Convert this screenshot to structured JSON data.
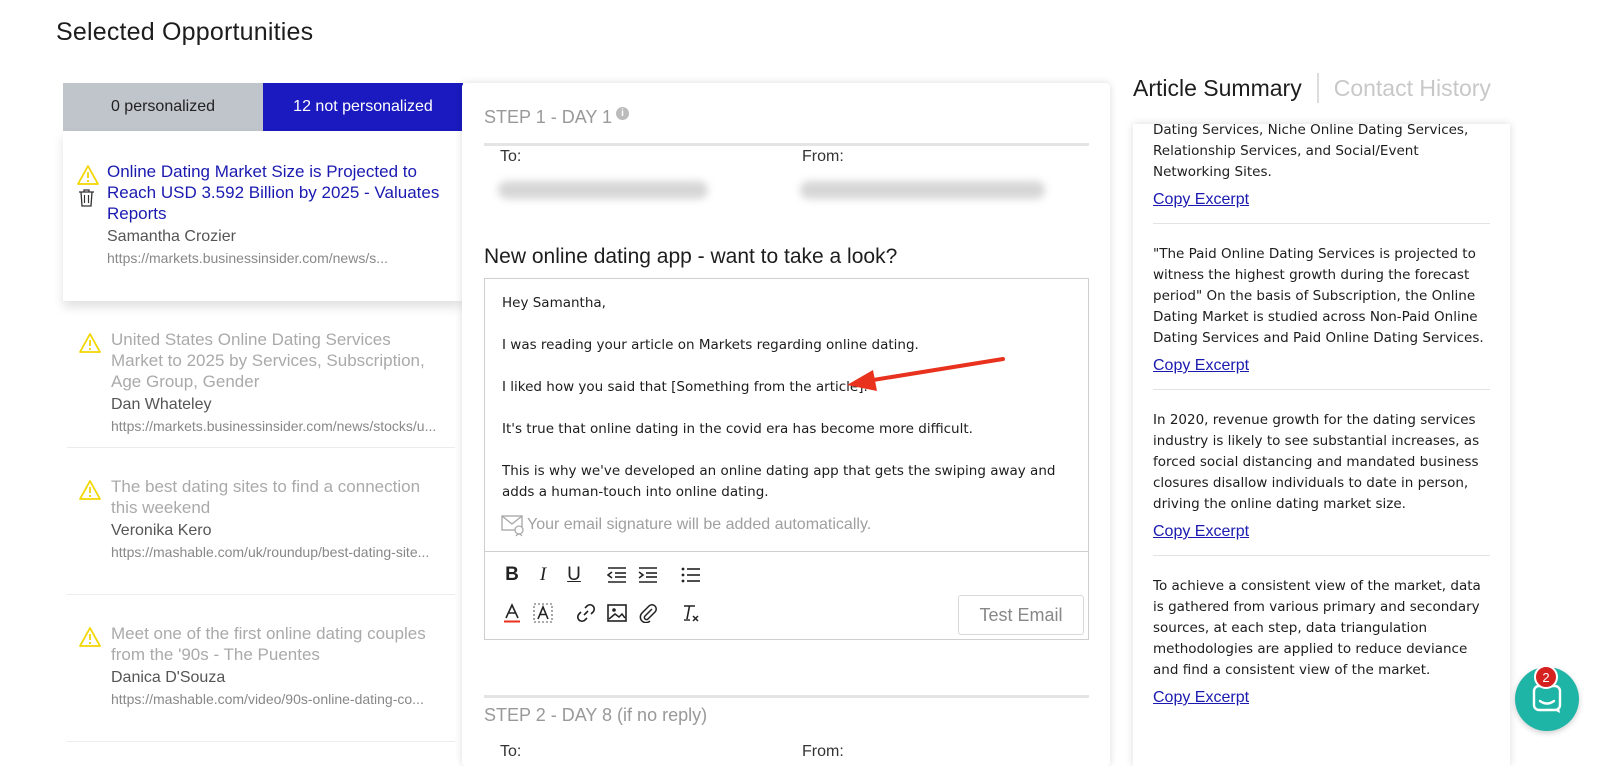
{
  "page_title": "Selected Opportunities",
  "tabs": {
    "personalized": "0 personalized",
    "not_personalized": "12 not personalized"
  },
  "opportunities": [
    {
      "title": "Online Dating Market Size is Projected to Reach USD 3.592 Billion by 2025 - Valuates Reports",
      "author": "Samantha Crozier",
      "url": "https://markets.businessinsider.com/news/s..."
    },
    {
      "title": "United States Online Dating Services Market to 2025 by Services, Subscription, Age Group, Gender",
      "author": "Dan Whateley",
      "url": "https://markets.businessinsider.com/news/stocks/u..."
    },
    {
      "title": "The best dating sites to find a connection this weekend",
      "author": "Veronika Kero",
      "url": "https://mashable.com/uk/roundup/best-dating-site..."
    },
    {
      "title": "Meet one of the first online dating couples from the '90s - The Puentes",
      "author": "Danica D'Souza",
      "url": "https://mashable.com/video/90s-online-dating-co..."
    }
  ],
  "step1": {
    "header": "STEP 1 - DAY 1",
    "to_label": "To:",
    "from_label": "From:",
    "subject": "New online dating app - want to take a look?",
    "body": [
      "Hey Samantha,",
      "I was reading your article on Markets regarding online dating.",
      "I liked how you said that [Something from the article].",
      "It's true that online dating in the covid era has become more difficult.",
      "This is why we've developed an online dating app that  gets the swiping away and adds a human-touch into online dating."
    ],
    "signature_note": "Your email signature will be added automatically.",
    "test_email": "Test Email"
  },
  "step2": {
    "header": "STEP 2 - DAY 8 (if no reply)",
    "to_label": "To:",
    "from_label": "From:"
  },
  "right_tabs": {
    "active": "Article Summary",
    "inactive": "Contact History"
  },
  "excerpts": [
    {
      "text": "Dating Services, Niche Online Dating Services, Relationship Services, and Social/Event Networking Sites.",
      "link": "Copy Excerpt"
    },
    {
      "text": "\"The Paid Online Dating Services is projected to witness the highest growth during the forecast period\" On the basis of Subscription, the Online Dating Market is studied across Non-Paid Online Dating Services and Paid Online Dating Services.",
      "link": "Copy Excerpt"
    },
    {
      "text": "In 2020, revenue growth for the dating services industry is likely to see substantial increases, as forced social distancing and mandated business closures disallow individuals to date in person, driving the online dating market size.",
      "link": "Copy Excerpt"
    },
    {
      "text": "To achieve a consistent view of the market, data is gathered from various primary and secondary sources, at each step, data triangulation methodologies are applied to reduce deviance and find a consistent view of the market.",
      "link": "Copy Excerpt"
    }
  ],
  "chat": {
    "badge": "2"
  },
  "colors": {
    "accent": "#1a1ac0",
    "warning": "#f2d600",
    "chat": "#1fb5a6",
    "arrow": "#e8321e"
  }
}
